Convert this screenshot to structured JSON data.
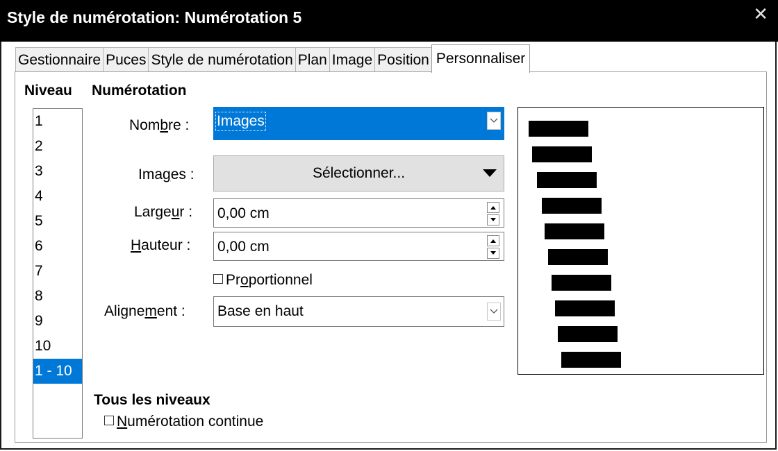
{
  "window": {
    "title": "Style de numérotation: Numérotation 5",
    "close_glyph": "✕"
  },
  "tabs": [
    {
      "label": "Gestionnaire"
    },
    {
      "label": "Puces"
    },
    {
      "label": "Style de numérotation"
    },
    {
      "label": "Plan"
    },
    {
      "label": "Image"
    },
    {
      "label": "Position"
    },
    {
      "label": "Personnaliser",
      "active": true
    }
  ],
  "level": {
    "heading": "Niveau",
    "items": [
      "1",
      "2",
      "3",
      "4",
      "5",
      "6",
      "7",
      "8",
      "9",
      "10",
      "1 - 10"
    ],
    "selected": "1 - 10"
  },
  "numbering": {
    "heading": "Numérotation",
    "number": {
      "label_pre": "Nom",
      "label_u": "b",
      "label_post": "re :",
      "value": "Images"
    },
    "images": {
      "label_pre": "Ima",
      "label_u": "g",
      "label_post": "es :",
      "button": "Sélectionner..."
    },
    "width": {
      "label_pre": "Large",
      "label_u": "u",
      "label_post": "r :",
      "value": "0,00 cm"
    },
    "height": {
      "label_pre": "",
      "label_u": "H",
      "label_post": "auteur :",
      "value": "0,00 cm"
    },
    "proportional": {
      "label_pre": "Pr",
      "label_u": "o",
      "label_post": "portionnel",
      "checked": false
    },
    "alignment": {
      "label_pre": "Aligne",
      "label_u": "m",
      "label_post": "ent :",
      "value": "Base en haut"
    }
  },
  "all_levels": {
    "heading": "Tous les niveaux",
    "continuous": {
      "label_u": "N",
      "label_post": "umérotation continue",
      "checked": false
    }
  },
  "colors": {
    "selection": "#0078d7",
    "titlebar": "#000000"
  }
}
